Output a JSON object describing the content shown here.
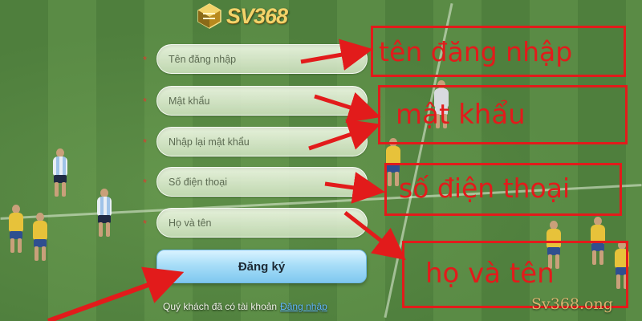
{
  "brand": {
    "logo_text": "SV368",
    "logo_icon": "hexagon-cube-logo"
  },
  "form": {
    "required_mark": "*",
    "fields": [
      {
        "placeholder": "Tên đăng nhập"
      },
      {
        "placeholder": "Mật khẩu"
      },
      {
        "placeholder": "Nhập lại mật khẩu"
      },
      {
        "placeholder": "Số điện thoại"
      },
      {
        "placeholder": "Họ và tên"
      }
    ],
    "submit_label": "Đăng ký",
    "login_prompt": "Quý khách đã có tài khoản",
    "login_link": "Đăng nhập"
  },
  "annotations": [
    {
      "label": "tên đăng nhập"
    },
    {
      "label": "mật khẩu"
    },
    {
      "label": "số điện thoại"
    },
    {
      "label": "họ và tên"
    }
  ],
  "watermark": "Sv368.ong",
  "colors": {
    "annotation": "#e21b1b",
    "button": "#a8def8",
    "link": "#5fb7ff",
    "logo": "#f3d36a"
  }
}
